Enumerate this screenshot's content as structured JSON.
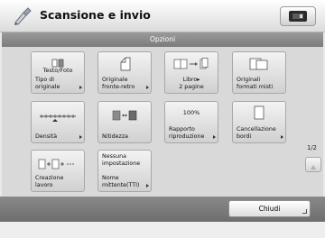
{
  "app": {
    "title": "Scansione e invio",
    "icon": "scan-pen-icon"
  },
  "header": {
    "title": "Opzioni"
  },
  "tiles": [
    {
      "top": "Testo/Foto",
      "label": "Tipo di\noriginale",
      "icon": "text-photo-icon"
    },
    {
      "label": "Originale\nfronte-retro",
      "icon": "duplex-original-icon"
    },
    {
      "label": "Libro▸\n2 pagine",
      "icon": "book-two-pages-icon"
    },
    {
      "label": "Originali\nformati misti",
      "icon": "mixed-originals-icon"
    },
    {
      "label": "Densità",
      "icon": "density-slider-icon"
    },
    {
      "label": "Nitidezza",
      "icon": "sharpness-icon"
    },
    {
      "top": "100%",
      "label": "Rapporto\nriproduzione",
      "icon": ""
    },
    {
      "label": "Cancellazione\nbordi",
      "icon": "erase-border-icon"
    },
    {
      "label": "Creazione\nlavoro",
      "icon": "job-build-icon"
    },
    {
      "top": "Nessuna\nimpostazione",
      "label": "Nome\nmittente(TTI)",
      "icon": ""
    }
  ],
  "pager": {
    "indicator": "1/2",
    "up_icon": "scroll-up-icon",
    "down_icon": "scroll-down-icon"
  },
  "footer": {
    "close_label": "Chiudi"
  }
}
